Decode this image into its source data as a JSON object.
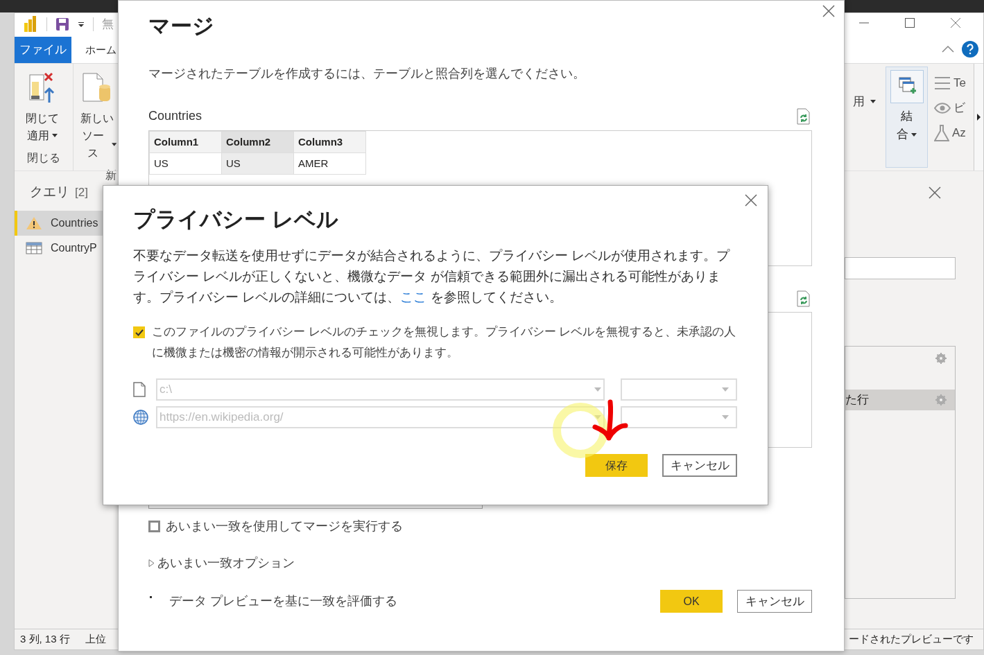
{
  "app": {
    "title": "無",
    "tabs": [
      {
        "label": "ファイル",
        "selected": true
      },
      {
        "label": "ホーム",
        "selected": false
      }
    ],
    "ribbon_buttons": [
      {
        "kind": "apply",
        "lines": [
          "閉じて",
          "適用"
        ]
      },
      {
        "kind": "source",
        "lines": [
          "新しい",
          "ソース"
        ]
      }
    ],
    "ribbon_groups": [
      "閉じる",
      "新"
    ],
    "ribbon_right": {
      "use_label": "用",
      "combine": [
        "結",
        "合"
      ],
      "side_items": [
        {
          "kind": "lines",
          "label": "Te"
        },
        {
          "kind": "eye",
          "label": "ビ"
        },
        {
          "kind": "flask",
          "label": "Az"
        }
      ]
    },
    "queries": {
      "title": "クエリ",
      "count": "[2]",
      "items": [
        {
          "name": "Countries",
          "warning": true,
          "selected": true
        },
        {
          "name": "CountryP",
          "warning": false,
          "selected": false
        }
      ]
    },
    "steps": [
      {
        "selected": false
      },
      {
        "label": "た行",
        "selected": true
      }
    ],
    "status_left": [
      "3 列, 13 行",
      "上位"
    ],
    "status_right": "ードされたプレビューです"
  },
  "merge": {
    "title": "マージ",
    "description": "マージされたテーブルを作成するには、テーブルと照合列を選んでください。",
    "table_name": "Countries",
    "columns": [
      {
        "label": "Column1",
        "selected": false
      },
      {
        "label": "Column2",
        "selected": true
      },
      {
        "label": "Column3",
        "selected": false
      }
    ],
    "rows": [
      [
        "US",
        "US",
        "AMER"
      ]
    ],
    "fuzzy": {
      "label": "あいまい一致を使用してマージを実行する",
      "checked": false
    },
    "fuzzy_options": {
      "label": "あいまい一致オプション",
      "expanded": false
    },
    "bullet": "データ プレビューを基に一致を評価する",
    "ok": "OK",
    "cancel": "キャンセル"
  },
  "privacy": {
    "title": "プライバシー レベル",
    "text_before": "不要なデータ転送を使用せずにデータが結合されるように、プライバシー レベルが使用されます。プライバシー レベルが正しくないと、機微なデータ が信頼できる範囲外に漏出される可能性があります。プライバシー レベルの詳細については、",
    "link": "ここ",
    "text_after": " を参照してください。",
    "ignore": {
      "label": "このファイルのプライバシー レベルのチェックを無視します。プライバシー レベルを無視すると、未承認の人に機微または機密の情報が開示される可能性があります。",
      "checked": true
    },
    "sources": [
      {
        "kind": "file",
        "value": "c:\\",
        "disabled": true
      },
      {
        "kind": "web",
        "value": "https://en.wikipedia.org/",
        "disabled": true
      }
    ],
    "save": "保存",
    "cancel": "キャンセル"
  }
}
